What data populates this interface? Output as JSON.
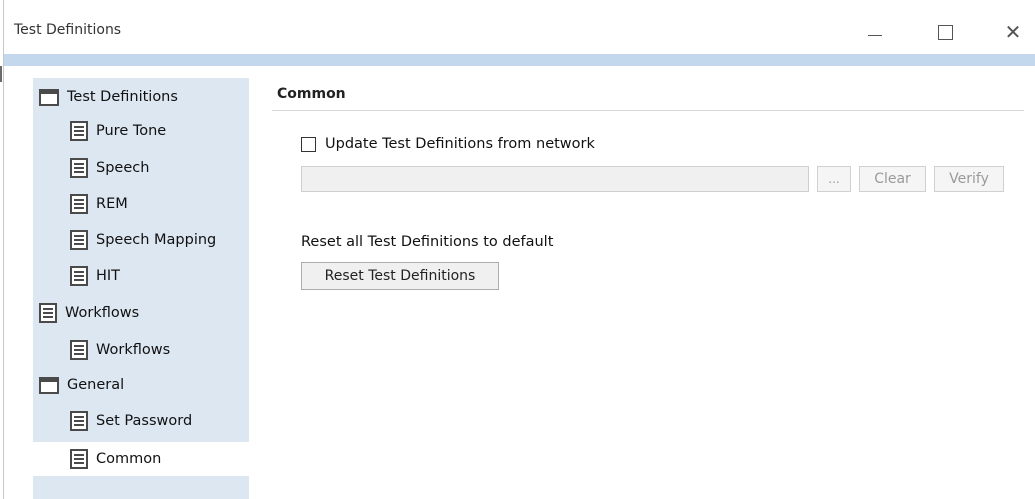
{
  "window": {
    "title": "Test Definitions",
    "controls": {
      "minimize": "—",
      "maximize": "☐",
      "close": "✕"
    }
  },
  "sidebar": {
    "items": [
      {
        "label": "Test Definitions",
        "icon": "folder-icon",
        "level": 0,
        "selected": false
      },
      {
        "label": "Pure Tone",
        "icon": "document-icon",
        "level": 1,
        "selected": false
      },
      {
        "label": "Speech",
        "icon": "document-icon",
        "level": 1,
        "selected": false
      },
      {
        "label": "REM",
        "icon": "document-icon",
        "level": 1,
        "selected": false
      },
      {
        "label": "Speech Mapping",
        "icon": "document-icon",
        "level": 1,
        "selected": false
      },
      {
        "label": "HIT",
        "icon": "document-icon",
        "level": 1,
        "selected": false
      },
      {
        "label": "Workflows",
        "icon": "document-icon",
        "level": 0,
        "selected": false
      },
      {
        "label": "Workflows",
        "icon": "document-icon",
        "level": 1,
        "selected": false
      },
      {
        "label": "General",
        "icon": "folder-icon",
        "level": 0,
        "selected": false
      },
      {
        "label": "Set Password",
        "icon": "document-icon",
        "level": 1,
        "selected": false
      },
      {
        "label": "Common",
        "icon": "document-icon",
        "level": 1,
        "selected": true
      }
    ]
  },
  "main": {
    "section_title": "Common",
    "update_checkbox": {
      "label": "Update Test Definitions from network",
      "checked": false
    },
    "network_path": {
      "value": "",
      "placeholder": ""
    },
    "browse_label": "...",
    "clear_label": "Clear",
    "verify_label": "Verify",
    "reset_label": "Reset all Test Definitions to default",
    "reset_button_label": "Reset Test Definitions"
  },
  "colors": {
    "sidebar_bg": "#dde7f1",
    "band": "#c3d8ec",
    "selected_bg": "#ffffff"
  }
}
